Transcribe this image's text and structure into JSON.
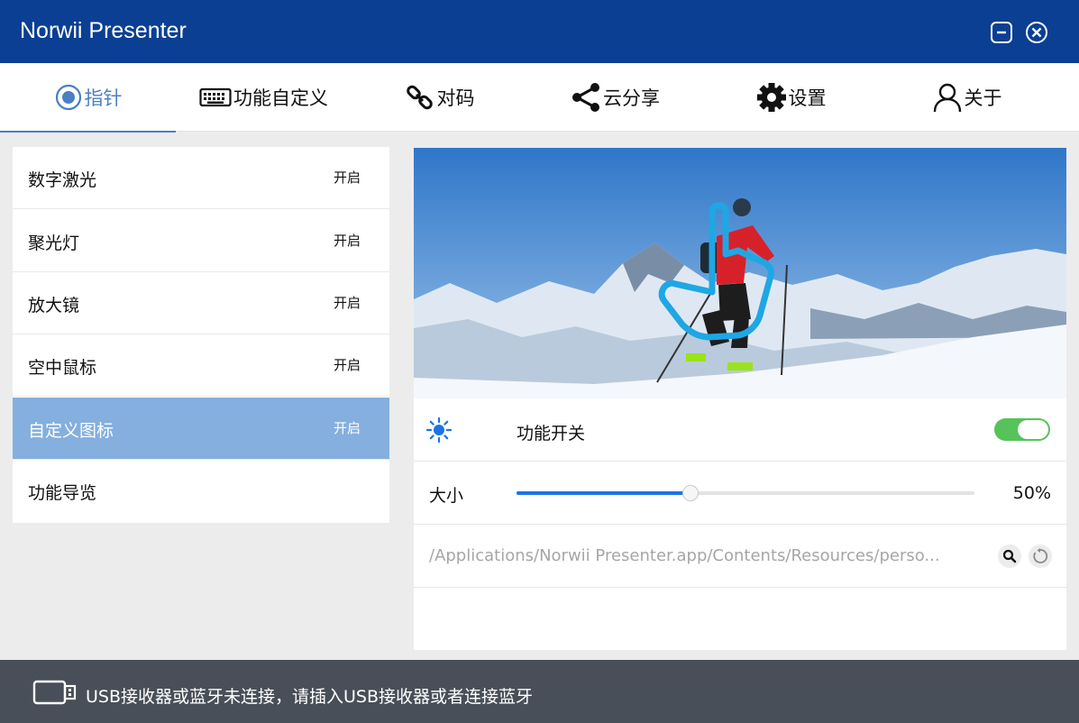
{
  "app": {
    "title": "Norwii Presenter"
  },
  "tabs": [
    {
      "label": "指针",
      "icon": "target-icon",
      "active": true
    },
    {
      "label": "功能自定义",
      "icon": "keyboard-icon",
      "active": false
    },
    {
      "label": "对码",
      "icon": "link-icon",
      "active": false
    },
    {
      "label": "云分享",
      "icon": "share-icon",
      "active": false
    },
    {
      "label": "设置",
      "icon": "gear-icon",
      "active": false
    },
    {
      "label": "关于",
      "icon": "user-icon",
      "active": false
    }
  ],
  "features": [
    {
      "label": "数字激光",
      "status": "开启",
      "selected": false
    },
    {
      "label": "聚光灯",
      "status": "开启",
      "selected": false
    },
    {
      "label": "放大镜",
      "status": "开启",
      "selected": false
    },
    {
      "label": "空中鼠标",
      "status": "开启",
      "selected": false
    },
    {
      "label": "自定义图标",
      "status": "开启",
      "selected": true
    },
    {
      "label": "功能导览",
      "status": "",
      "selected": false
    }
  ],
  "panel": {
    "toggle_label": "功能开关",
    "toggle_on": true,
    "size_label": "大小",
    "size_value": "50%",
    "size_fraction": 0.38,
    "path": "/Applications/Norwii Presenter.app/Contents/Resources/perso..."
  },
  "status": {
    "message": "USB接收器或蓝牙未连接，请插入USB接收器或者连接蓝牙"
  },
  "colors": {
    "titlebar": "#0b3f93",
    "accent": "#4a7fc1",
    "selected_row": "#84afdf",
    "toggle_on": "#55c35a",
    "slider_fill": "#1a73e8",
    "statusbar": "#494f58"
  }
}
